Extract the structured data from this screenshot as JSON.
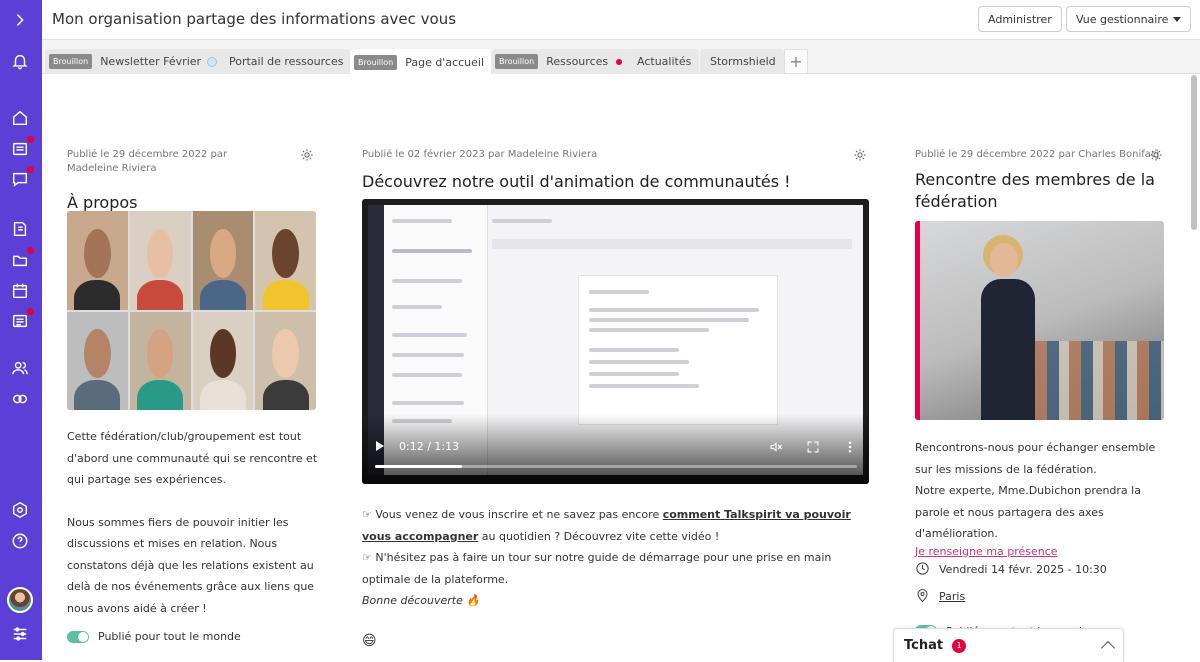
{
  "header": {
    "title": "Mon organisation partage des informations avec vous",
    "admin_button": "Administrer",
    "view_select": "Vue gestionnaire"
  },
  "tabs": [
    {
      "badge": "Brouillon",
      "label": "Newsletter Février",
      "active": false
    },
    {
      "badge": "",
      "label": "Portail de ressources",
      "active": false
    },
    {
      "badge": "Brouillon",
      "label": "Page d'accueil",
      "active": true
    },
    {
      "badge": "Brouillon",
      "label": "Ressources",
      "active": false
    },
    {
      "badge": "",
      "label": "Actualités",
      "active": false
    },
    {
      "badge": "",
      "label": "Stormshield",
      "active": false
    }
  ],
  "col1": {
    "meta": "Publié le 29 décembre 2022 par Madeleine Riviera",
    "title": "À propos",
    "paragraph1": "Cette fédération/club/groupement est tout d'abord une communauté qui se rencontre et qui partage ses expériences.",
    "paragraph2": "Nous sommes fiers de pouvoir initier les discussions et mises en relation. Nous constatons déjà que les relations existent au delà de nos événements grâce aux liens que nous avons aidé à créer !",
    "published": "Publié pour tout le monde"
  },
  "col2": {
    "meta": "Publié le 02 février 2023 par Madeleine Riviera",
    "title": "Découvrez notre outil d'animation de communautés !",
    "video_time": "0:12 / 1:13",
    "video_progress": 0.18,
    "line1_pre": "☞ Vous venez de vous inscrire et ne savez pas encore ",
    "line1_link": "comment Talkspirit va pouvoir vous accompagner",
    "line1_post": " au quotidien ? Découvrez vite cette vidéo !",
    "line2": "☞ N'hésitez pas à faire un tour sur notre guide de démarrage pour une prise en main optimale de la plateforme.",
    "line3": "Bonne découverte 🔥",
    "emoji": "😄"
  },
  "col3": {
    "meta": "Publié le 29 décembre 2022 par Charles Bonifacj",
    "title": "Rencontre des membres de la fédération",
    "paragraph1": "Rencontrons-nous pour échanger ensemble sur les missions de la fédération.",
    "paragraph2": "Notre experte, Mme.Dubichon prendra la parole et nous partagera des axes d'amélioration.",
    "rsvp_link": "Je renseigne ma présence",
    "date": "Vendredi 14 févr. 2025 - 10:30",
    "location": "Paris",
    "published": "Publié pour tout le monde"
  },
  "chat": {
    "label": "Tchat",
    "count": "1"
  },
  "colors": {
    "sidebar": "#5b3fd6",
    "notification": "#e5003d",
    "toggle": "#5bc2a6",
    "link_pink": "#d0347a"
  },
  "icons": [
    "chevron-right-icon",
    "bell-icon",
    "home-icon",
    "news-icon",
    "chat-icon",
    "book-icon",
    "folder-icon",
    "calendar-icon",
    "list-icon",
    "users-icon",
    "link-icon",
    "settings-icon",
    "help-icon",
    "sliders-icon",
    "gear-icon",
    "play-icon",
    "mute-icon",
    "fullscreen-icon",
    "more-icon",
    "clock-icon",
    "pin-icon",
    "chevron-up-icon"
  ]
}
